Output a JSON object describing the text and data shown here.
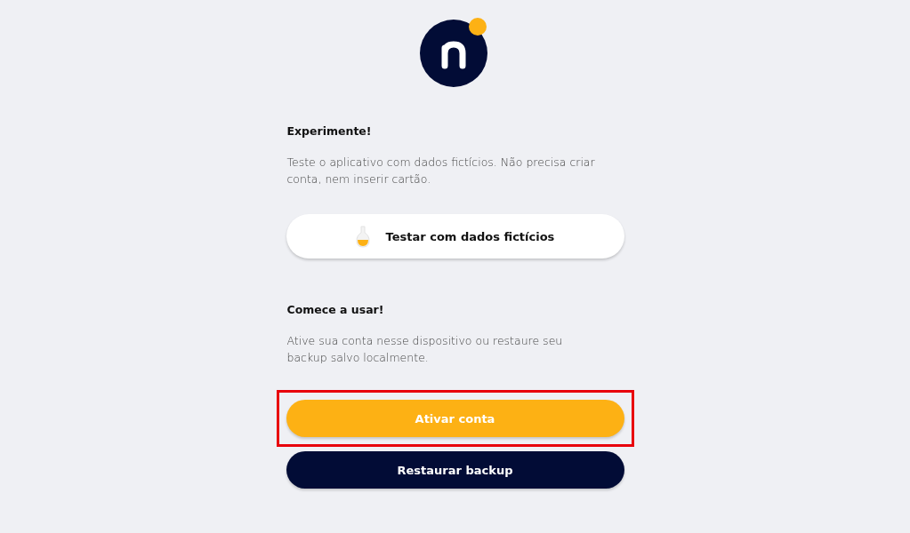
{
  "sections": [
    {
      "title": "Experimente!",
      "text": "Teste o aplicativo com dados fictícios. Não precisa criar conta, nem inserir cartão.",
      "buttons": [
        {
          "label": "Testar com dados fictícios",
          "kind": "light"
        }
      ]
    },
    {
      "title": "Comece a usar!",
      "text": "Ative sua conta nesse dispositivo ou restaure seu backup salvo localmente.",
      "buttons": [
        {
          "label": "Ativar conta",
          "kind": "primary",
          "highlighted": true
        },
        {
          "label": "Restaurar backup",
          "kind": "dark"
        }
      ]
    }
  ]
}
